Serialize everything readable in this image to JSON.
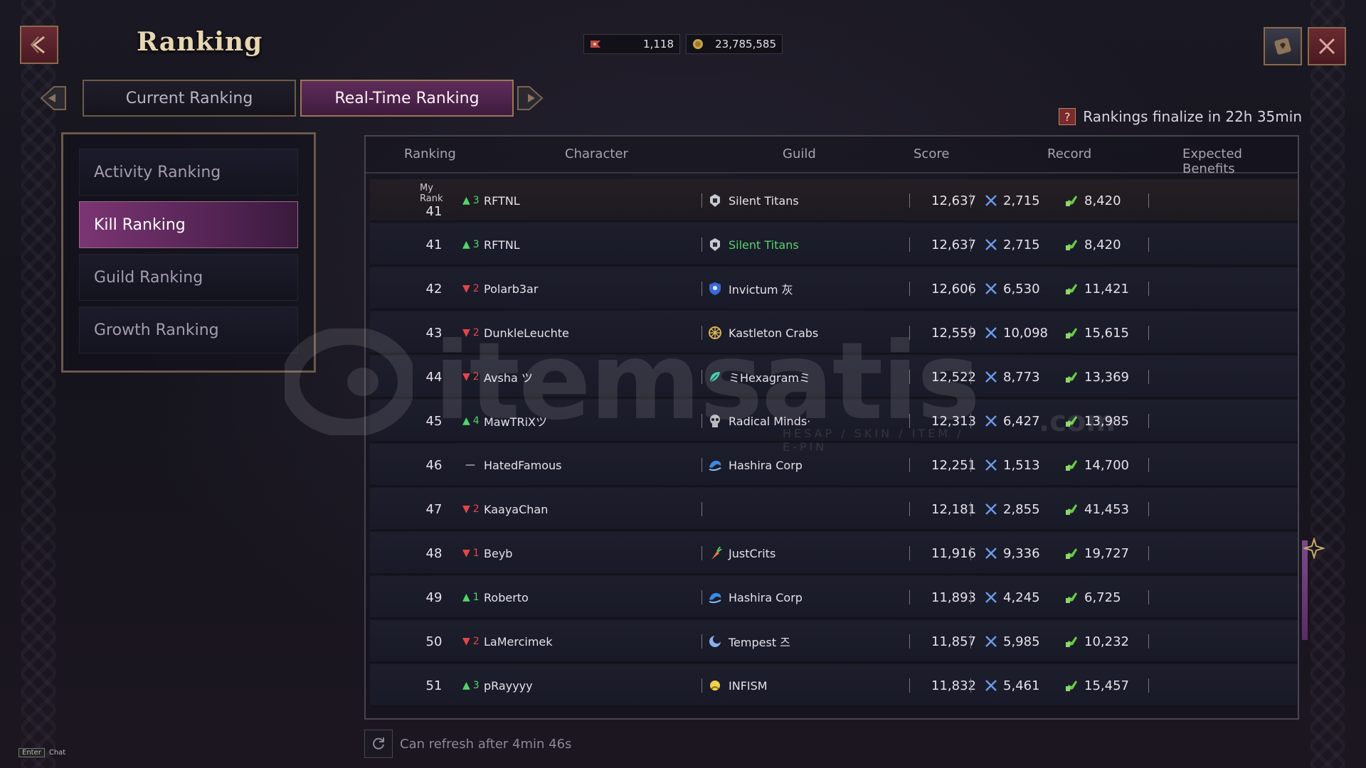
{
  "header": {
    "title": "Ranking",
    "currency": [
      {
        "icon": "ticket-icon",
        "value": "1,118"
      },
      {
        "icon": "coin-icon",
        "value": "23,785,585"
      }
    ]
  },
  "tabs": [
    {
      "label": "Current Ranking",
      "active": false
    },
    {
      "label": "Real-Time Ranking",
      "active": true
    }
  ],
  "finalize_text": "Rankings finalize in 22h 35min",
  "help_glyph": "?",
  "menu": [
    {
      "label": "Activity Ranking",
      "active": false
    },
    {
      "label": "Kill Ranking",
      "active": true
    },
    {
      "label": "Guild Ranking",
      "active": false
    },
    {
      "label": "Growth Ranking",
      "active": false
    }
  ],
  "table": {
    "columns": [
      "Ranking",
      "Character",
      "Guild",
      "Score",
      "Record",
      "Expected Benefits"
    ],
    "my_rank_label": "My Rank",
    "my_row": {
      "rank": "41",
      "dir": "up",
      "change": "3",
      "character": "RFTNL",
      "guild": "Silent Titans",
      "guild_icon": "helmet-icon",
      "score": "12,637",
      "kills": "2,715",
      "assists": "8,420"
    },
    "rows": [
      {
        "rank": "41",
        "dir": "up",
        "change": "3",
        "character": "RFTNL",
        "guild": "Silent Titans",
        "guild_icon": "helmet-icon",
        "score": "12,637",
        "kills": "2,715",
        "assists": "8,420",
        "highlight": true
      },
      {
        "rank": "42",
        "dir": "down",
        "change": "2",
        "character": "Polarb3ar",
        "guild": "Invictum 灰",
        "guild_icon": "shield-icon",
        "score": "12,606",
        "kills": "6,530",
        "assists": "11,421"
      },
      {
        "rank": "43",
        "dir": "down",
        "change": "2",
        "character": "DunkleLeuchte",
        "guild": "Kastleton Crabs",
        "guild_icon": "wheel-icon",
        "score": "12,559",
        "kills": "10,098",
        "assists": "15,615"
      },
      {
        "rank": "44",
        "dir": "down",
        "change": "2",
        "character": "Avsha ツ",
        "guild": "ミHexagramミ",
        "guild_icon": "leaf-icon",
        "score": "12,522",
        "kills": "8,773",
        "assists": "13,369"
      },
      {
        "rank": "45",
        "dir": "up",
        "change": "4",
        "character": "MawTRiXツ",
        "guild": "Radical Minds·",
        "guild_icon": "skull-icon",
        "score": "12,313",
        "kills": "6,427",
        "assists": "13,985"
      },
      {
        "rank": "46",
        "dir": "same",
        "change": "—",
        "character": "HatedFamous",
        "guild": "Hashira Corp",
        "guild_icon": "wave-icon",
        "score": "12,251",
        "kills": "1,513",
        "assists": "14,700"
      },
      {
        "rank": "47",
        "dir": "down",
        "change": "2",
        "character": "KaayaChan",
        "guild": "",
        "guild_icon": "",
        "score": "12,181",
        "kills": "2,855",
        "assists": "41,453"
      },
      {
        "rank": "48",
        "dir": "down",
        "change": "1",
        "character": "Beyb",
        "guild": "JustCrits",
        "guild_icon": "carrot-icon",
        "score": "11,916",
        "kills": "9,336",
        "assists": "19,727"
      },
      {
        "rank": "49",
        "dir": "up",
        "change": "1",
        "character": "Roberto",
        "guild": "Hashira Corp",
        "guild_icon": "wave-icon",
        "score": "11,893",
        "kills": "4,245",
        "assists": "6,725"
      },
      {
        "rank": "50",
        "dir": "down",
        "change": "2",
        "character": "LaMercimek",
        "guild": "Tempest 즈",
        "guild_icon": "moon-icon",
        "score": "11,857",
        "kills": "5,985",
        "assists": "10,232"
      },
      {
        "rank": "51",
        "dir": "up",
        "change": "3",
        "character": "pRayyyy",
        "guild": "INFISM",
        "guild_icon": "sun-icon",
        "score": "11,832",
        "kills": "5,461",
        "assists": "15,457"
      }
    ]
  },
  "refresh_text": "Can refresh after 4min 46s",
  "footer": {
    "key": "Enter",
    "label": "Chat"
  },
  "watermark": {
    "text": "itemsatis",
    "sub": "HESAP / SKIN / ITEM / E-PIN",
    "domain": ".com"
  },
  "colors": {
    "accent": "#7b3573",
    "up": "#56d36c",
    "down": "#e04848",
    "gold": "#e8d6b0"
  }
}
